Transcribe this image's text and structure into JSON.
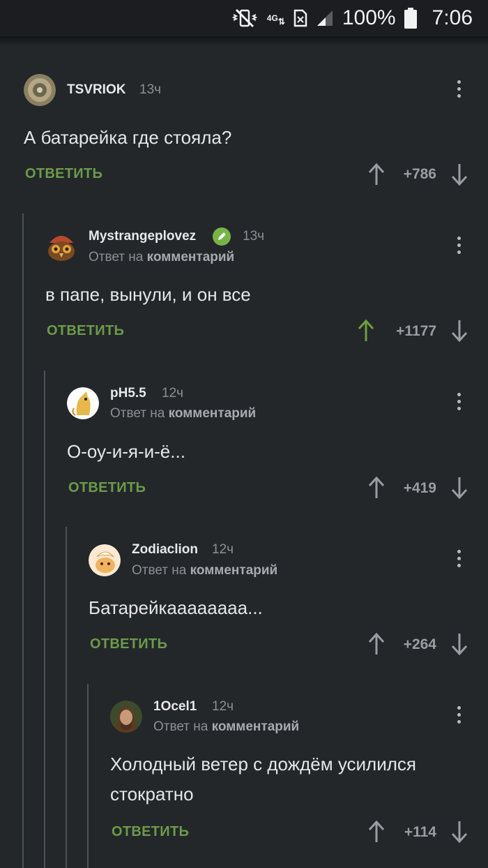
{
  "status_bar": {
    "network": "4G",
    "battery": "100%",
    "time": "7:06"
  },
  "labels": {
    "reply_to_prefix": "Ответ на",
    "reply_to_target": "комментарий",
    "reply_button": "ОТВЕТИТЬ"
  },
  "comments": [
    {
      "author": "TSVRIOK",
      "time": "13ч",
      "text": "А батарейка где стояла?",
      "rating": "+786",
      "upvoted": false
    },
    {
      "author": "Mystrangeplovez",
      "time": "13ч",
      "text": "в папе, вынули, и он все",
      "rating": "+1177",
      "upvoted": true,
      "verified": true
    },
    {
      "author": "pH5.5",
      "time": "12ч",
      "text": "О-оу-и-я-и-ё...",
      "rating": "+419",
      "upvoted": false
    },
    {
      "author": "Zodiaclion",
      "time": "12ч",
      "text": "Батарейкаааааааа...",
      "rating": "+264",
      "upvoted": false
    },
    {
      "author": "1Ocel1",
      "time": "12ч",
      "text": "Холодный ветер с дождём усилился стократно",
      "rating": "+114",
      "upvoted": false
    }
  ],
  "colors": {
    "background": "#23272a",
    "reply_green": "#6d9a4a",
    "upvote_active": "#6f9f3c",
    "muted": "#8c9094"
  }
}
